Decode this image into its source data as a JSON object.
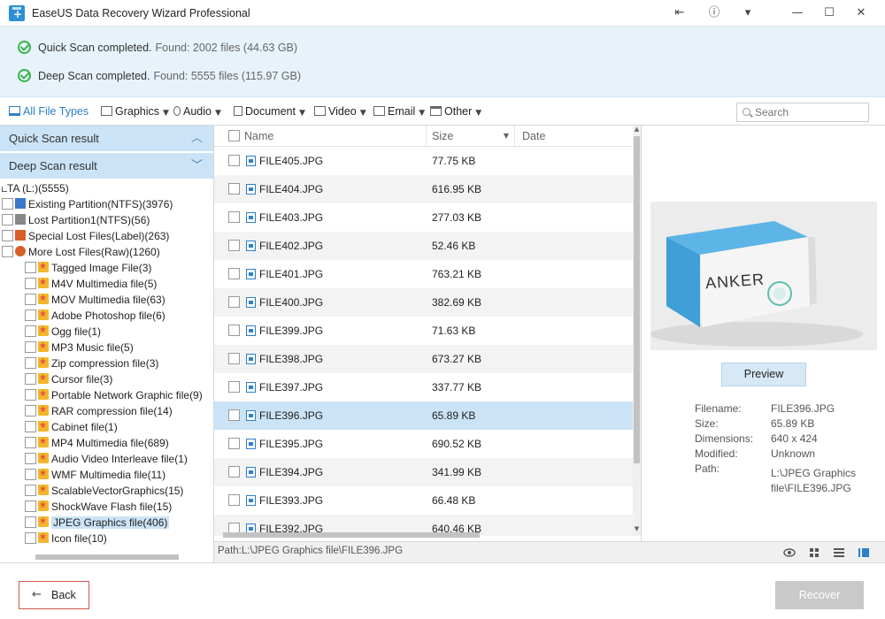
{
  "window": {
    "title": "EaseUS Data Recovery Wizard Professional",
    "controls": {
      "minimize": "—",
      "maximize": "☐",
      "close": "✕"
    }
  },
  "status": [
    {
      "title": "Quick Scan completed.",
      "detail": "Found: 2002 files (44.63 GB)"
    },
    {
      "title": "Deep Scan completed.",
      "detail": "Found: 5555 files (115.97 GB)"
    }
  ],
  "filters": [
    {
      "label": "All File Types",
      "icon": "monitor-icon",
      "active": true
    },
    {
      "label": "Graphics",
      "icon": "image-icon"
    },
    {
      "label": "Audio",
      "icon": "music-icon"
    },
    {
      "label": "Document",
      "icon": "document-icon"
    },
    {
      "label": "Video",
      "icon": "video-icon"
    },
    {
      "label": "Email",
      "icon": "email-icon"
    },
    {
      "label": "Other",
      "icon": "folder-icon"
    }
  ],
  "search": {
    "placeholder": "Search"
  },
  "sidebar": {
    "quick_scan": "Quick Scan result",
    "deep_scan": "Deep Scan result",
    "tree": [
      {
        "label": "TA (L:)(5555)"
      },
      {
        "label": "Existing Partition(NTFS)(3976)"
      },
      {
        "label": "Lost Partition1(NTFS)(56)"
      },
      {
        "label": "Special Lost Files(Label)(263)"
      },
      {
        "label": "More Lost Files(Raw)(1260)"
      },
      {
        "label": "Tagged Image File(3)"
      },
      {
        "label": "M4V Multimedia file(5)"
      },
      {
        "label": "MOV Multimedia file(63)"
      },
      {
        "label": "Adobe Photoshop file(6)"
      },
      {
        "label": "Ogg file(1)"
      },
      {
        "label": "MP3 Music file(5)"
      },
      {
        "label": "Zip compression file(3)"
      },
      {
        "label": "Cursor file(3)"
      },
      {
        "label": "Portable Network Graphic file(9)"
      },
      {
        "label": "RAR compression file(14)"
      },
      {
        "label": "Cabinet file(1)"
      },
      {
        "label": "MP4 Multimedia file(689)"
      },
      {
        "label": "Audio Video Interleave file(1)"
      },
      {
        "label": "WMF Multimedia file(11)"
      },
      {
        "label": "ScalableVectorGraphics(15)"
      },
      {
        "label": "ShockWave Flash file(15)"
      },
      {
        "label": "JPEG Graphics file(406)"
      },
      {
        "label": "Icon file(10)"
      }
    ]
  },
  "list": {
    "columns": {
      "name": "Name",
      "size": "Size",
      "date": "Date"
    },
    "rows": [
      {
        "name": "FILE405.JPG",
        "size": "77.75 KB"
      },
      {
        "name": "FILE404.JPG",
        "size": "616.95 KB"
      },
      {
        "name": "FILE403.JPG",
        "size": "277.03 KB"
      },
      {
        "name": "FILE402.JPG",
        "size": "52.46 KB"
      },
      {
        "name": "FILE401.JPG",
        "size": "763.21 KB"
      },
      {
        "name": "FILE400.JPG",
        "size": "382.69 KB"
      },
      {
        "name": "FILE399.JPG",
        "size": "71.63 KB"
      },
      {
        "name": "FILE398.JPG",
        "size": "673.27 KB"
      },
      {
        "name": "FILE397.JPG",
        "size": "337.77 KB"
      },
      {
        "name": "FILE396.JPG",
        "size": "65.89 KB"
      },
      {
        "name": "FILE395.JPG",
        "size": "690.52 KB"
      },
      {
        "name": "FILE394.JPG",
        "size": "341.99 KB"
      },
      {
        "name": "FILE393.JPG",
        "size": "66.48 KB"
      },
      {
        "name": "FILE392.JPG",
        "size": "640.46 KB"
      }
    ]
  },
  "preview": {
    "image_text": "ANKER",
    "button": "Preview",
    "info": {
      "filename_label": "Filename:",
      "filename": "FILE396.JPG",
      "size_label": "Size:",
      "size": "65.89 KB",
      "dimensions_label": "Dimensions:",
      "dimensions": "640 x 424",
      "modified_label": "Modified:",
      "modified": "Unknown",
      "path_label": "Path:",
      "path_line1": "L:\\JPEG Graphics",
      "path_line2": "file\\FILE396.JPG"
    }
  },
  "pathbar": {
    "path": "Path:L:\\JPEG Graphics file\\FILE396.JPG"
  },
  "bottom": {
    "back": "Back",
    "recover": "Recover"
  },
  "colors": {
    "accent": "#2c7fc9",
    "selected": "#cbe3f6",
    "status_bg": "#e7f2fa",
    "back_border": "#d0584a"
  }
}
